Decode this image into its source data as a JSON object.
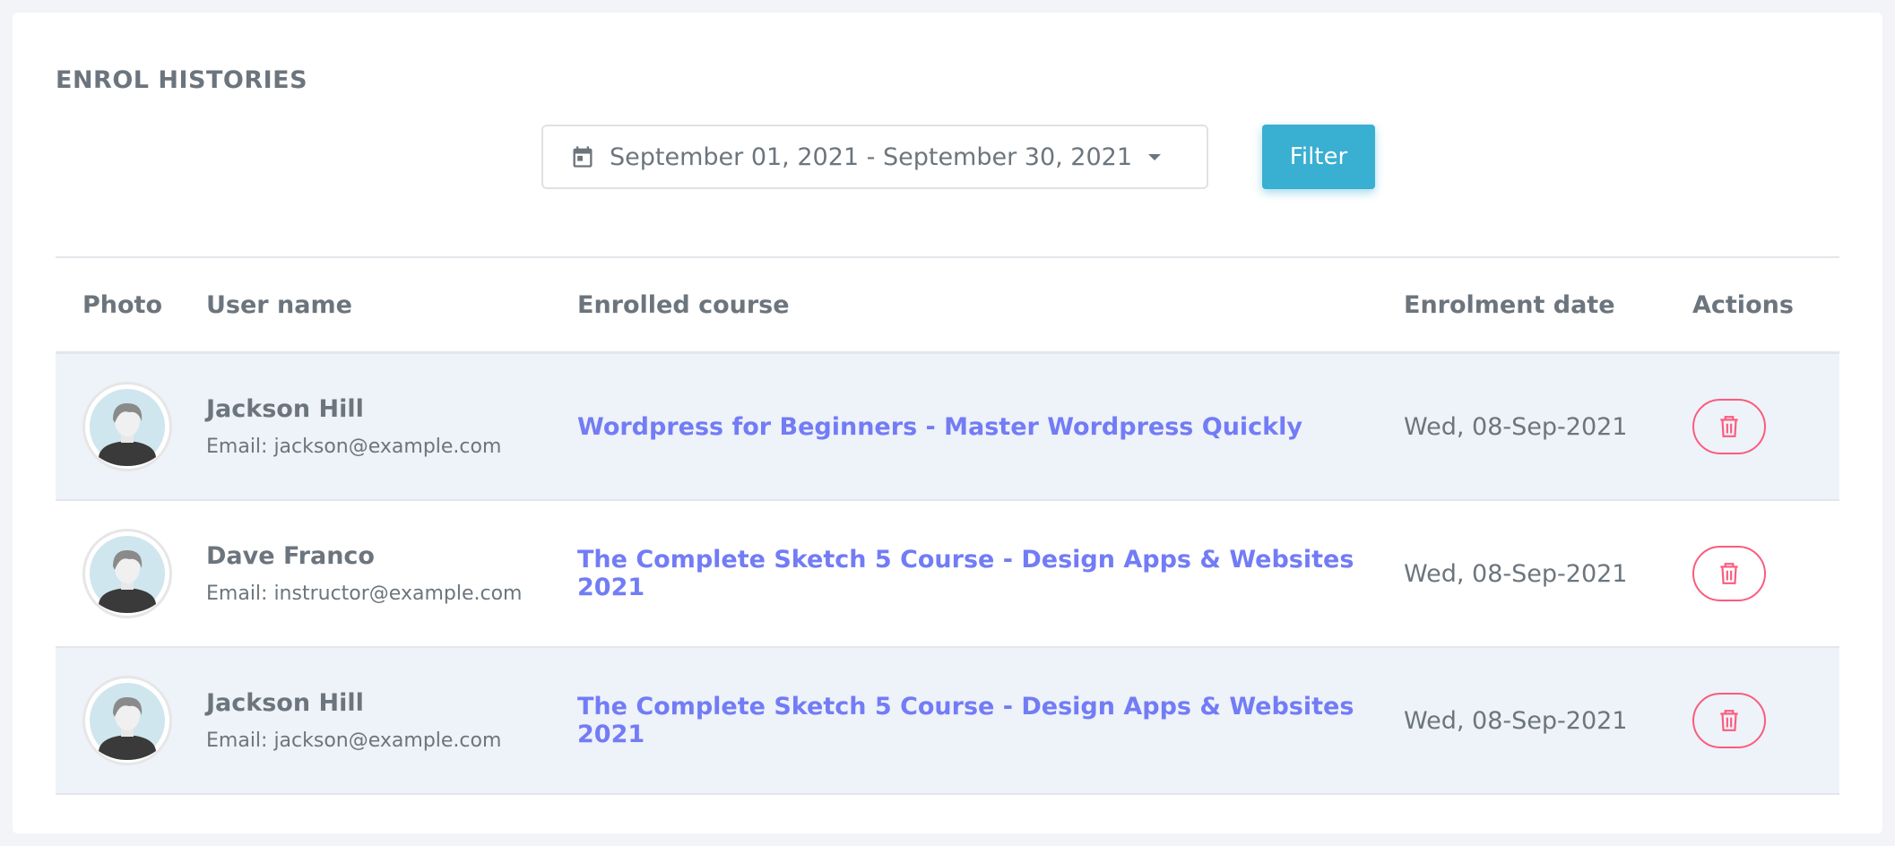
{
  "page": {
    "title": "ENROL HISTORIES"
  },
  "filter": {
    "date_range": "September 01, 2021 - September 30, 2021",
    "button_label": "Filter"
  },
  "table": {
    "headers": {
      "photo": "Photo",
      "user_name": "User name",
      "enrolled_course": "Enrolled course",
      "enrolment_date": "Enrolment date",
      "actions": "Actions"
    },
    "rows": [
      {
        "name": "Jackson Hill",
        "email": "Email: jackson@example.com",
        "course": "Wordpress for Beginners - Master Wordpress Quickly",
        "date": "Wed, 08-Sep-2021"
      },
      {
        "name": "Dave Franco",
        "email": "Email: instructor@example.com",
        "course": "The Complete Sketch 5 Course - Design Apps & Websites 2021",
        "date": "Wed, 08-Sep-2021"
      },
      {
        "name": "Jackson Hill",
        "email": "Email: jackson@example.com",
        "course": "The Complete Sketch 5 Course - Design Apps & Websites 2021",
        "date": "Wed, 08-Sep-2021"
      }
    ]
  },
  "colors": {
    "accent_link": "#727cf5",
    "filter_button": "#39afd1",
    "danger": "#fa5c7c",
    "stripe": "#eef2f9"
  },
  "icons": {
    "date_picker": "calendar-icon",
    "date_picker_dropdown": "caret-down-icon",
    "delete": "trash-icon",
    "photo": "avatar-placeholder"
  }
}
